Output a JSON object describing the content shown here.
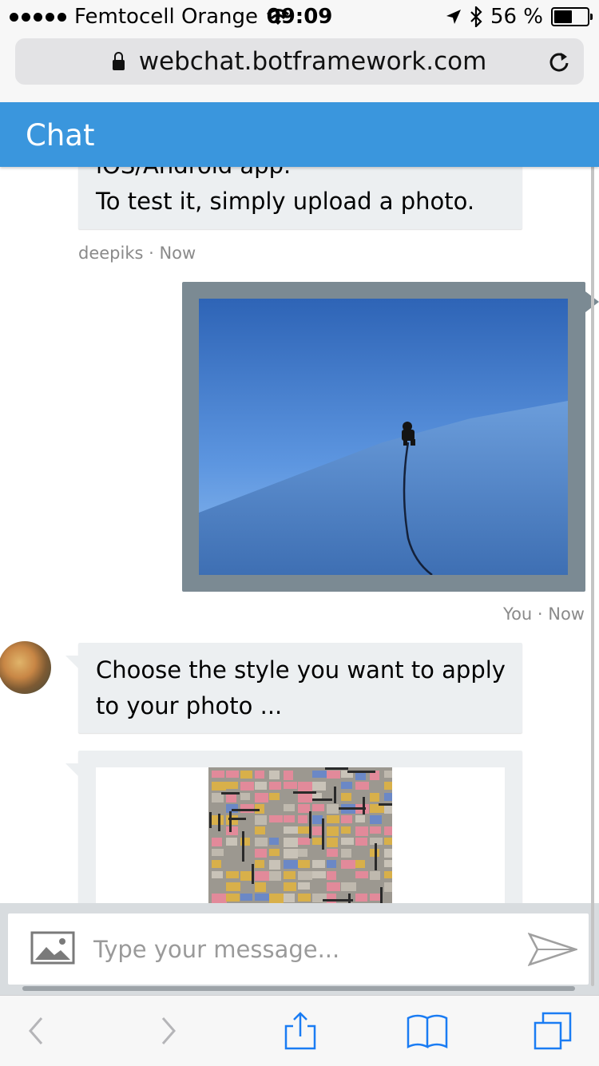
{
  "status_bar": {
    "carrier": "Femtocell Orange",
    "time": "09:09",
    "battery_percent": "56 %",
    "icons": [
      "signal-dots-icon",
      "wifi-icon",
      "location-arrow-icon",
      "bluetooth-icon",
      "battery-icon"
    ]
  },
  "browser": {
    "url": "webchat.botframework.com",
    "icons": [
      "lock-icon",
      "reload-icon"
    ]
  },
  "chat": {
    "title": "Chat",
    "messages": [
      {
        "lines": [
          "iOS/Android app.",
          "To test it, simply upload a photo."
        ],
        "meta": "deepiks · Now"
      },
      {
        "type": "image",
        "meta": "You · Now"
      },
      {
        "text": "Choose the style you want to apply to your photo ..."
      },
      {
        "type": "card-image"
      }
    ],
    "accent": "#3a96dd",
    "bubble_bg": "#eceff1"
  },
  "input": {
    "placeholder": "Type your message...",
    "icons": [
      "image-upload-icon",
      "send-icon"
    ]
  },
  "toolbar": {
    "icons": [
      "back-icon",
      "forward-icon",
      "share-icon",
      "bookmarks-icon",
      "tabs-icon"
    ]
  }
}
